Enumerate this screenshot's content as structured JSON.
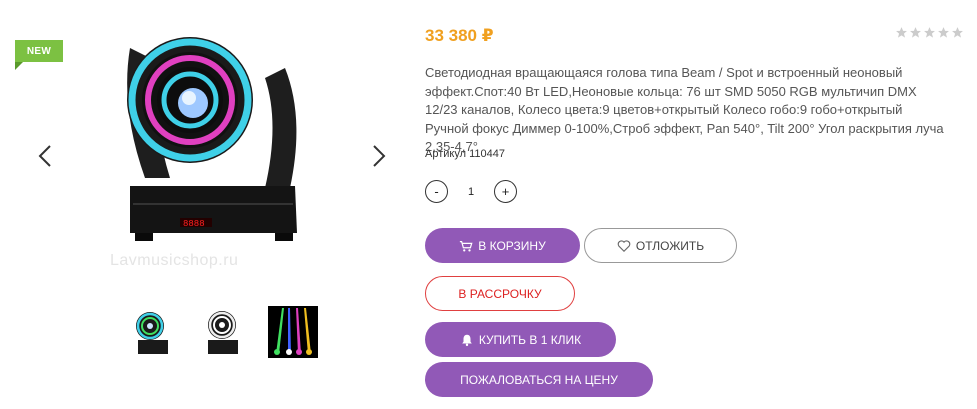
{
  "badge": {
    "label": "NEW"
  },
  "gallery": {
    "watermark": "Lavmusicshop.ru",
    "prev_icon": "chevron-left-icon",
    "next_icon": "chevron-right-icon",
    "thumbnails": [
      "thumb-moving-head-green-ring",
      "thumb-moving-head-white-ring",
      "thumb-beam-effects"
    ]
  },
  "product": {
    "price": "33 380 ₽",
    "rating": {
      "stars": 0,
      "max": 5
    },
    "description": "Светодиодная вращающаяся голова типа Beam / Spot и встроенный неоновый эффект.Спот:40 Вт LED,Неоновые кольца: 76 шт SMD 5050 RGB мультичип DMX 12/23 каналов, Колесо цвета:9 цветов+открытый Колесо гобо:9 гобо+открытый Ручной фокус Диммер 0-100%,Строб эффект, Pan 540°, Tilt 200° Угол раскрытия луча 2,35-4,7°",
    "sku": "Артикул 110447"
  },
  "quantity": {
    "minus_label": "-",
    "value": "1",
    "plus_label": "+"
  },
  "buttons": {
    "cart": "В КОРЗИНУ",
    "postpone": "ОТЛОЖИТЬ",
    "installment": "В РАССРОЧКУ",
    "one_click": "КУПИТЬ В 1 КЛИК",
    "complain_price": "ПОЖАЛОВАТЬСЯ НА ЦЕНУ"
  },
  "colors": {
    "price": "#f0a020",
    "accent_purple": "#9159b7",
    "installment_red": "#e04040",
    "badge_green": "#7cc142"
  }
}
